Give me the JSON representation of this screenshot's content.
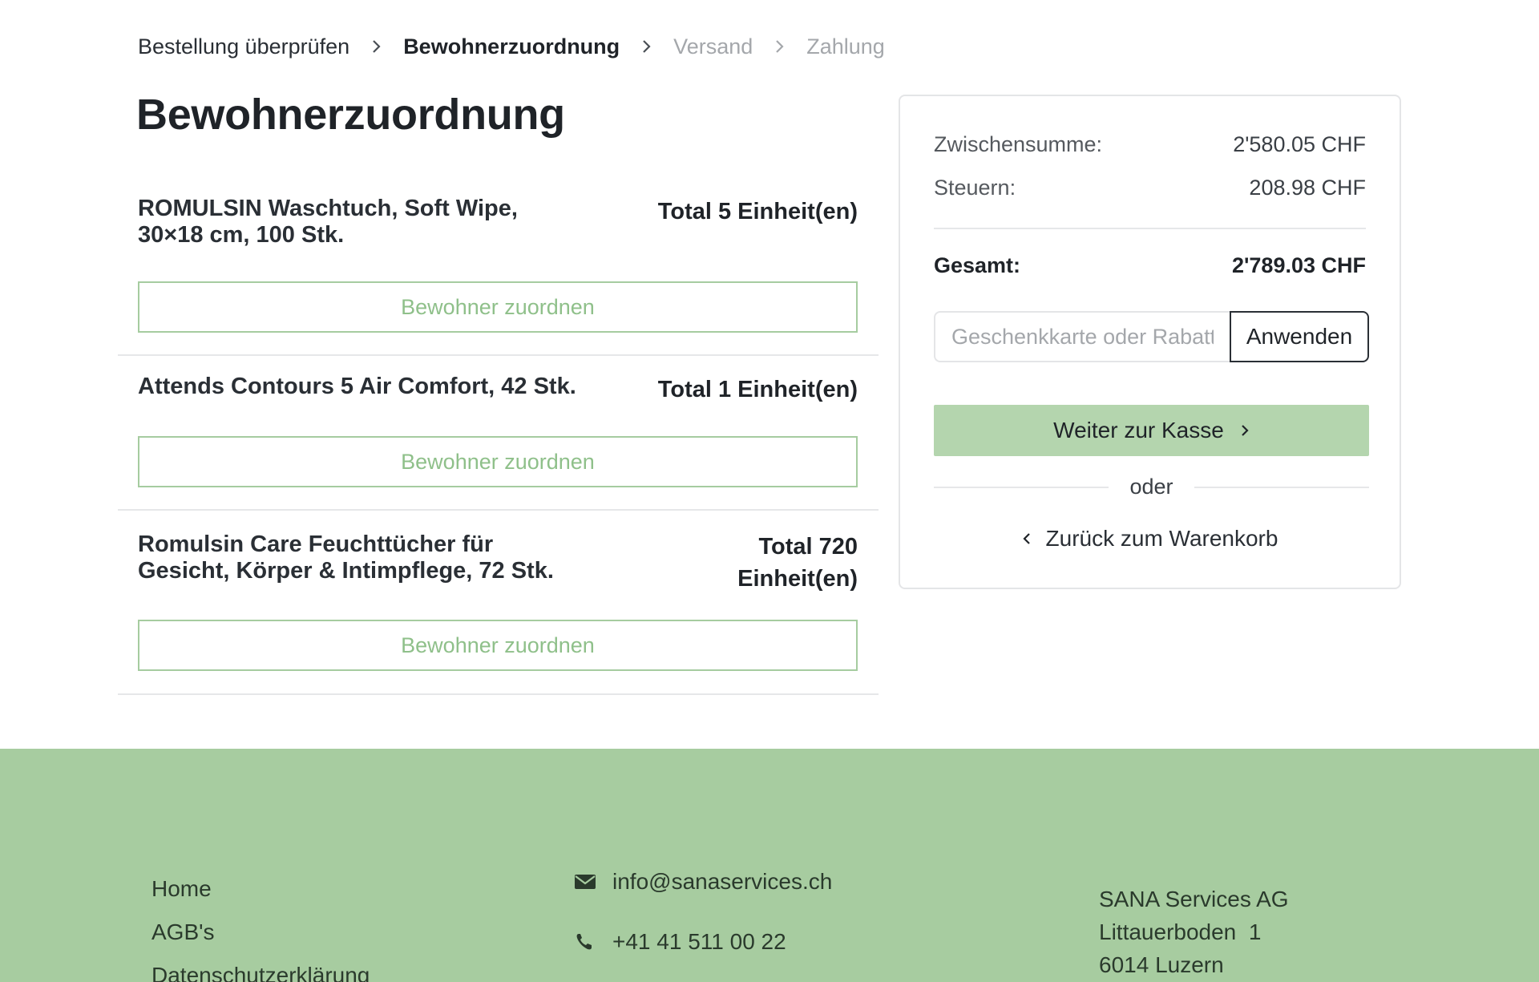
{
  "breadcrumb": {
    "steps": [
      "Bestellung überprüfen",
      "Bewohnerzuordnung",
      "Versand",
      "Zahlung"
    ]
  },
  "page": {
    "title": "Bewohnerzuordnung"
  },
  "items": [
    {
      "name": "ROMULSIN Waschtuch, Soft Wipe, 30×18 cm, 100 Stk.",
      "total": "Total 5 Einheit(en)",
      "button": "Bewohner zuordnen"
    },
    {
      "name": "Attends Contours 5 Air Comfort, 42 Stk.",
      "total": "Total 1 Einheit(en)",
      "button": "Bewohner zuordnen"
    },
    {
      "name": "Romulsin Care Feuchttücher für Gesicht, Körper & Intimpflege, 72 Stk.",
      "total": "Total 720 Einheit(en)",
      "button": "Bewohner zuordnen"
    }
  ],
  "summary": {
    "subtotal_label": "Zwischensumme:",
    "subtotal_value": "2'580.05 CHF",
    "tax_label": "Steuern:",
    "tax_value": "208.98 CHF",
    "total_label": "Gesamt:",
    "total_value": "2'789.03 CHF",
    "coupon_placeholder": "Geschenkkarte oder Rabattcode",
    "coupon_button": "Anwenden",
    "checkout_button": "Weiter zur Kasse",
    "or_text": "oder",
    "back_link": "Zurück zum Warenkorb"
  },
  "footer": {
    "links": [
      "Home",
      "AGB's",
      "Datenschutzerklärung"
    ],
    "email": "info@sanaservices.ch",
    "phone": "+41 41 511 00 22",
    "address": [
      "SANA Services AG",
      "Littauerboden  1",
      "6014 Luzern"
    ]
  },
  "colors": {
    "accent_green": "#b4d5ae",
    "footer_green": "#a7cca0",
    "assign_text_green": "#8fc08a",
    "muted_text": "#a4a7ab"
  },
  "icons": {
    "breadcrumb_separator": "chevron-right-icon",
    "checkout": "chevron-right-icon",
    "back": "chevron-left-icon",
    "email": "envelope-icon",
    "phone": "phone-icon"
  }
}
